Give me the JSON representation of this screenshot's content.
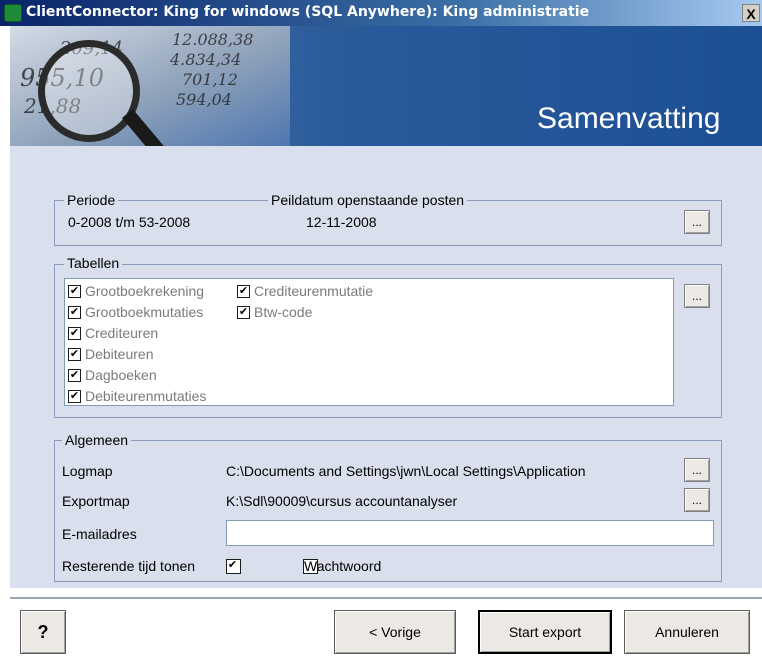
{
  "window": {
    "title": "ClientConnector: King for windows (SQL Anywhere): King administratie",
    "close_label": "X"
  },
  "header": {
    "title": "Samenvatting",
    "ledger_numbers": [
      "12.088,38",
      "4.834,34",
      "701,12",
      "594,04",
      "955,10",
      "21,88",
      "209,14"
    ]
  },
  "periode": {
    "legend": "Periode",
    "value": "0-2008 t/m 53-2008",
    "peildatum_label": "Peildatum openstaande posten",
    "peildatum_value": "12-11-2008",
    "browse_label": "..."
  },
  "tabellen": {
    "legend": "Tabellen",
    "browse_label": "...",
    "items": [
      {
        "label": "Grootboekrekening",
        "checked": true
      },
      {
        "label": "Grootboekmutaties",
        "checked": true
      },
      {
        "label": "Crediteuren",
        "checked": true
      },
      {
        "label": "Debiteuren",
        "checked": true
      },
      {
        "label": "Dagboeken",
        "checked": true
      },
      {
        "label": "Debiteurenmutaties",
        "checked": true
      },
      {
        "label": "Crediteurenmutatie",
        "checked": true
      },
      {
        "label": "Btw-code",
        "checked": true
      }
    ]
  },
  "algemeen": {
    "legend": "Algemeen",
    "logmap_label": "Logmap",
    "logmap_value": "C:\\Documents and Settings\\jwn\\Local Settings\\Application",
    "exportmap_label": "Exportmap",
    "exportmap_value": "K:\\Sdl\\90009\\cursus accountanalyser",
    "email_label": "E-mailadres",
    "email_value": "",
    "resterende_label": "Resterende tijd tonen",
    "resterende_checked": true,
    "wachtwoord_label": "Wachtwoord",
    "wachtwoord_checked": false,
    "browse_label": "..."
  },
  "footer": {
    "help_label": "?",
    "back_label": "< Vorige",
    "start_label": "Start export",
    "cancel_label": "Annuleren"
  },
  "colors": {
    "title_bar": "#0a246a",
    "header_banner": "#1d4f95",
    "content_bg": "#d9dfec"
  }
}
